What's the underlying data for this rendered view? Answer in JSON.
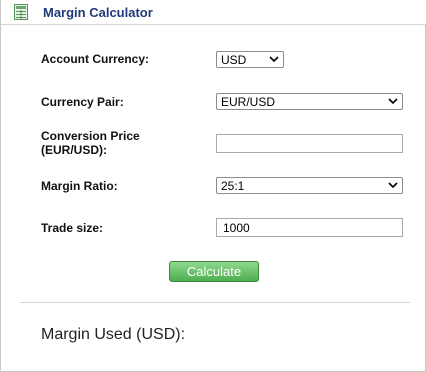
{
  "window": {
    "title": "Margin Calculator",
    "icon": "calculator-sheet-icon"
  },
  "form": {
    "account_currency": {
      "label": "Account Currency:",
      "value": "USD"
    },
    "currency_pair": {
      "label": "Currency Pair:",
      "value": "EUR/USD"
    },
    "conversion_price": {
      "label_line1": "Conversion Price",
      "label_line2": "(EUR/USD):",
      "value": ""
    },
    "margin_ratio": {
      "label": "Margin Ratio:",
      "value": "25:1"
    },
    "trade_size": {
      "label": "Trade size:",
      "value": "1000"
    }
  },
  "actions": {
    "calculate_label": "Calculate"
  },
  "result": {
    "prefix": "Margin Used (",
    "currency": "USD",
    "suffix": "):"
  },
  "colors": {
    "title": "#1f3a7a",
    "button_green": "#4fae4f"
  }
}
